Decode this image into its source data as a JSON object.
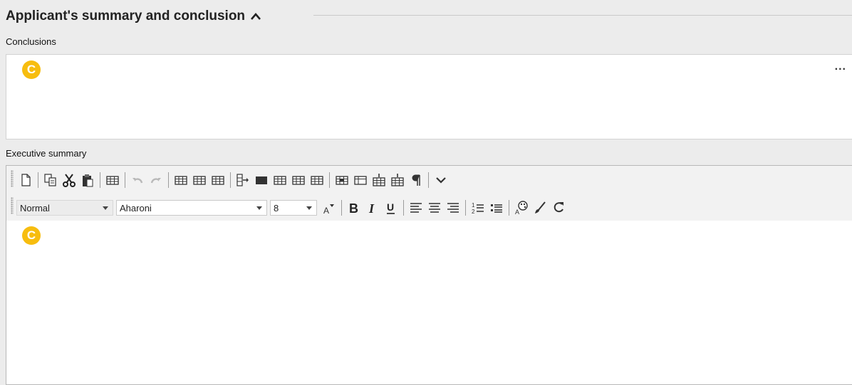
{
  "section": {
    "title": "Applicant's summary and conclusion"
  },
  "conclusions": {
    "label": "Conclusions",
    "badge": "C",
    "more": "..."
  },
  "executive_summary": {
    "label": "Executive summary",
    "badge": "C",
    "toolbar": {
      "style_value": "Normal",
      "font_value": "Aharoni",
      "size_value": "8"
    }
  },
  "colors": {
    "badge": "#f7bd0f",
    "icon": "#2b2b2b",
    "disabled_icon": "#b9b9b9"
  }
}
